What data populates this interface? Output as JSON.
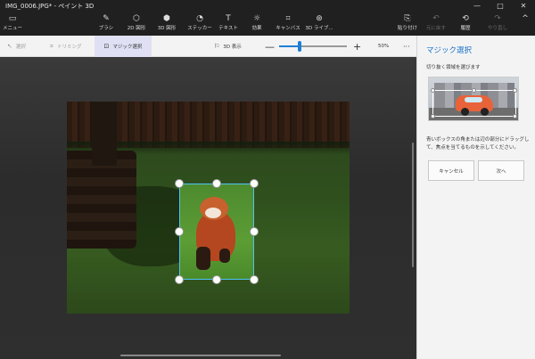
{
  "window": {
    "title": "IMG_0006.JPG* - ペイント 3D",
    "minimize": "—",
    "maximize": "□",
    "close": "✕"
  },
  "ribbon": {
    "menu": {
      "label": "メニュー",
      "icon": "hamburger-icon"
    },
    "tools": [
      {
        "label": "ブラシ",
        "icon": "brush-icon"
      },
      {
        "label": "2D 図形",
        "icon": "shapes-2d-icon"
      },
      {
        "label": "3D 図形",
        "icon": "cube-icon"
      },
      {
        "label": "ステッカー",
        "icon": "sticker-icon"
      },
      {
        "label": "テキスト",
        "icon": "text-icon"
      },
      {
        "label": "効果",
        "icon": "effects-icon"
      },
      {
        "label": "キャンバス",
        "icon": "canvas-icon"
      },
      {
        "label": "3D ライブ...",
        "icon": "library-3d-icon"
      }
    ],
    "right_tools": [
      {
        "label": "貼り付け",
        "icon": "paste-icon"
      },
      {
        "label": "元に戻す",
        "icon": "undo-icon"
      },
      {
        "label": "履歴",
        "icon": "history-icon"
      },
      {
        "label": "やり直し",
        "icon": "redo-icon"
      }
    ],
    "collapse": "^"
  },
  "toolbar": {
    "select": "選択",
    "crop": "トリミング",
    "magic_select": "マジック選択",
    "view_3d": "3D 表示",
    "zoom_minus": "—",
    "zoom_plus": "+",
    "zoom_percent": "50%",
    "zoom_level": 0.3,
    "more": "···"
  },
  "panel": {
    "title": "マジック選択",
    "hint": "切り抜く領域を選びます",
    "description": "青いボックスの角または辺の部分にドラッグして、焦点を当てるものを示してください。",
    "cancel": "キャンセル",
    "next": "次へ"
  },
  "colors": {
    "accent": "#1e7fd6",
    "selection_border": "#4fc3f7"
  }
}
